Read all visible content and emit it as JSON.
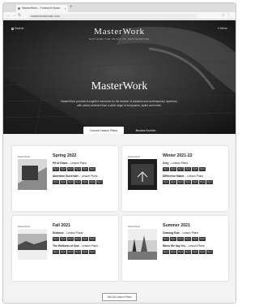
{
  "browser": {
    "tab_title": "MasterWork - Featured Music",
    "url": "masterworkmusic.com"
  },
  "header": {
    "search_label": "Search",
    "logo": "MasterWork",
    "logo_subtitle": "EXPLORE THE MUSIC OF MASTERWORK",
    "menu_label": "Menu"
  },
  "hero": {
    "title": "MasterWork",
    "description": "MasterWork provides thoughtful resources for the teacher of classical and contemporary repertoire, with pieces selected from a wide range of composers, styles and levels.",
    "primary_button": "Current Lesson Plans",
    "secondary_link": "Browse Archive"
  },
  "cards": [
    {
      "thumb_label": "MasterWork",
      "title": "Spring 2022",
      "tracks": [
        {
          "name": "Pit of Grace",
          "suffix": "Lesson Plans",
          "pages": [
            "Pg 1",
            "Pg 2",
            "Pg 3",
            "Pg 4",
            "Pg 5",
            "Pg 6"
          ]
        },
        {
          "name": "Aberdeen Surrender",
          "suffix": "Lesson Plans",
          "pages": [
            "Pg 1",
            "Pg 2",
            "Pg 3",
            "Pg 4",
            "Pg 5",
            "Pg 6",
            "Pg 7"
          ]
        }
      ]
    },
    {
      "thumb_label": "MasterWork",
      "title": "Winter 2021-22",
      "tracks": [
        {
          "name": "Grey",
          "suffix": "Lesson Plans",
          "pages": [
            "Pg 1",
            "Pg 2",
            "Pg 3",
            "Pg 4",
            "Pg 5",
            "Pg 6"
          ]
        },
        {
          "name": "Difference Maker",
          "suffix": "Lesson Plans",
          "pages": [
            "Pg 1",
            "Pg 2",
            "Pg 3",
            "Pg 4",
            "Pg 5",
            "Pg 6",
            "Pg 7"
          ]
        }
      ]
    },
    {
      "thumb_label": "MasterWork",
      "title": "Fall 2021",
      "tracks": [
        {
          "name": "Distance",
          "suffix": "Lesson Plans",
          "pages": [
            "Pg 1",
            "Pg 2",
            "Pg 3",
            "Pg 4",
            "Pg 5",
            "Pg 6"
          ]
        },
        {
          "name": "The Wellness of God",
          "suffix": "Lesson Plans",
          "pages": [
            "Pg 1",
            "Pg 2",
            "Pg 3",
            "Pg 4",
            "Pg 5",
            "Pg 6"
          ]
        }
      ]
    },
    {
      "thumb_label": "MasterWork",
      "title": "Summer 2021",
      "tracks": [
        {
          "name": "Chasing God",
          "suffix": "Lesson Plans",
          "pages": [
            "Pg 1",
            "Pg 2",
            "Pg 3",
            "Pg 4",
            "Pg 5",
            "Pg 6"
          ]
        },
        {
          "name": "When We Say Yes",
          "suffix": "Lesson Plans",
          "pages": [
            "Pg 1",
            "Pg 2",
            "Pg 3",
            "Pg 4",
            "Pg 5",
            "Pg 6",
            "Pg 7"
          ]
        }
      ]
    }
  ],
  "more_button": "See All Lesson Plans"
}
